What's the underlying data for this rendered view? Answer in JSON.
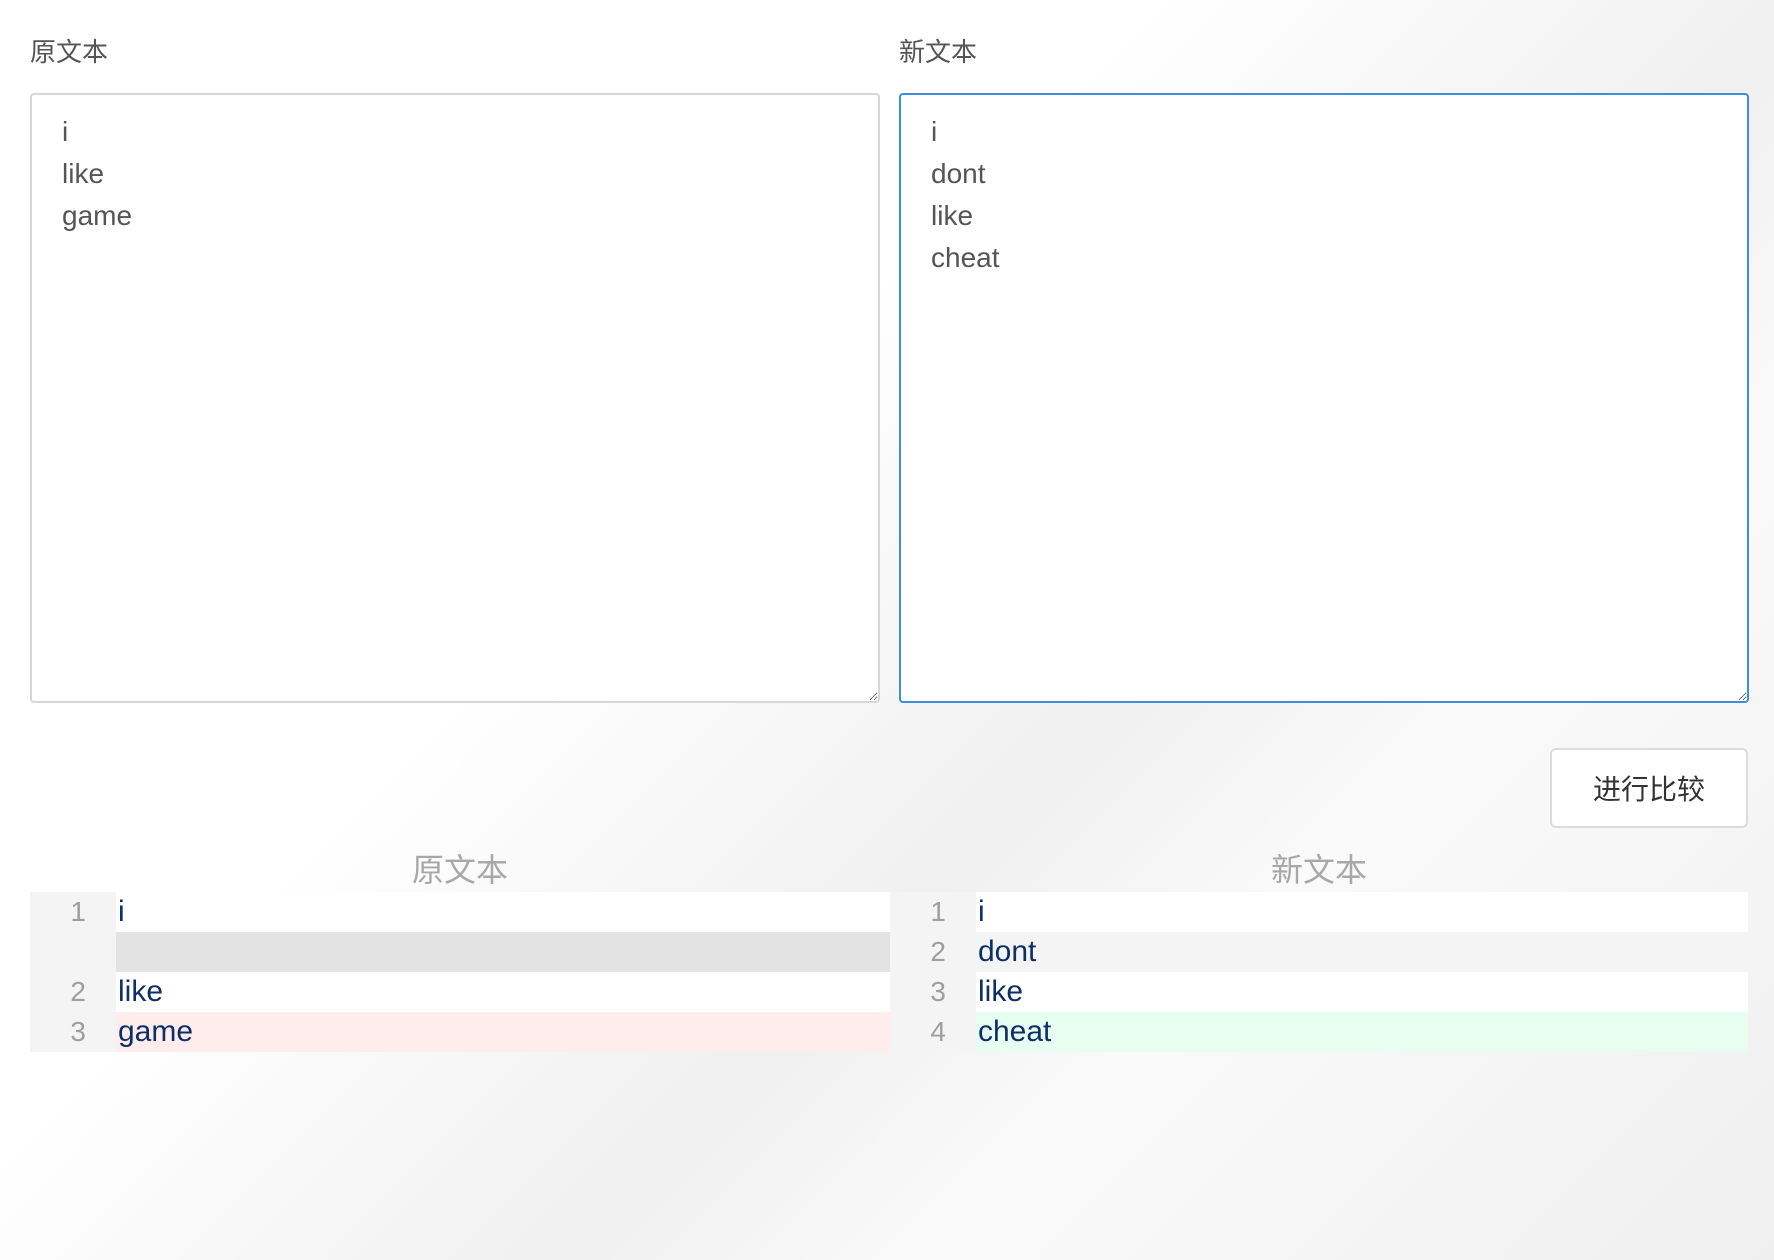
{
  "editors": {
    "original": {
      "label": "原文本",
      "value": "i\nlike\ngame"
    },
    "modified": {
      "label": "新文本",
      "value": "i\ndont\nlike\ncheat"
    }
  },
  "compare_button": {
    "label": "进行比较"
  },
  "diff": {
    "left": {
      "title": "原文本",
      "rows": [
        {
          "line": "1",
          "text": "i",
          "state": "equal"
        },
        {
          "line": "",
          "text": "",
          "state": "filler"
        },
        {
          "line": "2",
          "text": "like",
          "state": "equal"
        },
        {
          "line": "3",
          "text": "game",
          "state": "deleted"
        }
      ]
    },
    "right": {
      "title": "新文本",
      "rows": [
        {
          "line": "1",
          "text": "i",
          "state": "equal"
        },
        {
          "line": "2",
          "text": "dont",
          "state": "inserted"
        },
        {
          "line": "3",
          "text": "like",
          "state": "equal"
        },
        {
          "line": "4",
          "text": "cheat",
          "state": "inserted"
        }
      ]
    }
  },
  "colors": {
    "focus_border": "#3d8ede",
    "deleted_bg": "#ffeded",
    "inserted_bg": "#e6fff0",
    "filler_bg": "#e3e3e3",
    "diff_text": "#0d2f67"
  }
}
